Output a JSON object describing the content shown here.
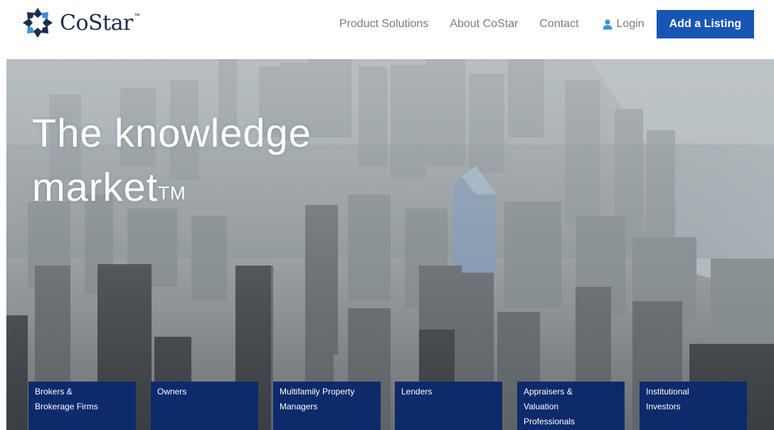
{
  "brand": {
    "name": "CoStar",
    "trademark": "™"
  },
  "nav": {
    "items": [
      "Product Solutions",
      "About CoStar",
      "Contact"
    ],
    "login": "Login",
    "cta": "Add a Listing"
  },
  "hero": {
    "title_line1": "The knowledge",
    "title_line2": "market",
    "title_mark": "TM"
  },
  "audiences": [
    {
      "line1": "Brokers &",
      "line2": "Brokerage Firms",
      "line3": ""
    },
    {
      "line1": "Owners",
      "line2": "",
      "line3": ""
    },
    {
      "line1": "Multifamily Property",
      "line2": "Managers",
      "line3": ""
    },
    {
      "line1": "Lenders",
      "line2": "",
      "line3": ""
    },
    {
      "line1": "Appraisers &",
      "line2": "Valuation",
      "line3": "Professionals"
    },
    {
      "line1": "Institutional",
      "line2": "Investors",
      "line3": ""
    }
  ],
  "colors": {
    "brand_navy": "#1f2b4d",
    "cta_blue": "#1856b6",
    "tile_navy": "#0d2a6b",
    "nav_gray": "#777b85"
  }
}
